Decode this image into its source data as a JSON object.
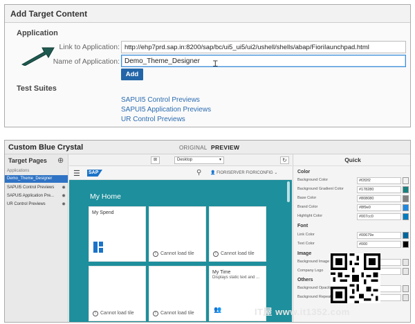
{
  "dialog": {
    "title": "Add Target Content",
    "section_application": "Application",
    "link_label": "Link to Application:",
    "link_value": "http://ehp7prd.sap.in:8200/sap/bc/ui5_ui5/ui2/ushell/shells/abap/FioriIaunchpad.html",
    "name_label": "Name of Application:",
    "name_value": "Demo_Theme_Designer",
    "add_button": "Add",
    "section_tests": "Test Suites",
    "test_links": [
      "SAPUI5 Control Previews",
      "SAPUI5 Application Previews",
      "UR Control Previews"
    ]
  },
  "designer": {
    "app_title": "Custom Blue Crystal",
    "mode_original": "ORIGINAL",
    "mode_preview": "PREVIEW",
    "left_panel": {
      "title": "Target Pages",
      "group_label": "Applications",
      "items": [
        "Demo_Theme_Designer",
        "SAPUI5 Control Previews",
        "SAPUI5 Application Pre...",
        "UR Control Previews"
      ]
    },
    "toolbar": {
      "device": "Desktop"
    },
    "preview": {
      "logo": "SAP",
      "user": "FIORISERVER FIORICONFIG",
      "page_title": "My Home",
      "tiles": [
        {
          "title": "My Spend",
          "subtitle": "",
          "error": ""
        },
        {
          "title": "",
          "subtitle": "",
          "error": "Cannot load tile"
        },
        {
          "title": "",
          "subtitle": "",
          "error": "Cannot load tile"
        },
        {
          "title": "",
          "subtitle": "",
          "error": "Cannot load tile"
        },
        {
          "title": "",
          "subtitle": "",
          "error": "Cannot load tile"
        },
        {
          "title": "My Time",
          "subtitle": "Displays static text and ...",
          "error": ""
        }
      ]
    },
    "right_panel": {
      "title": "Quick",
      "sections": {
        "color": "Color",
        "font": "Font",
        "image": "Image",
        "others": "Others"
      },
      "color_rows": [
        {
          "label": "Background Color",
          "value": "#f2f2f2",
          "swatch": "#f2f2f2"
        },
        {
          "label": "Background Gradient Color",
          "value": "#178280",
          "swatch": "#178280"
        },
        {
          "label": "Base Color",
          "value": "#808080",
          "swatch": "#808080"
        },
        {
          "label": "Brand Color",
          "value": "#8f9e0",
          "swatch": "#1e88e0"
        },
        {
          "label": "Highlight Color",
          "value": "#007cc0",
          "swatch": "#007cc0"
        }
      ],
      "font_rows": [
        {
          "label": "Link Color",
          "value": "#00679e",
          "swatch": "#00679e"
        },
        {
          "label": "Text Color",
          "value": "#000",
          "swatch": "#000000"
        }
      ],
      "image_rows": [
        "Background Image",
        "Company Logo"
      ],
      "other_rows": [
        "Background Opacity",
        "Background Repeat"
      ]
    }
  },
  "watermark": "IT屋 www.it1352.com"
}
